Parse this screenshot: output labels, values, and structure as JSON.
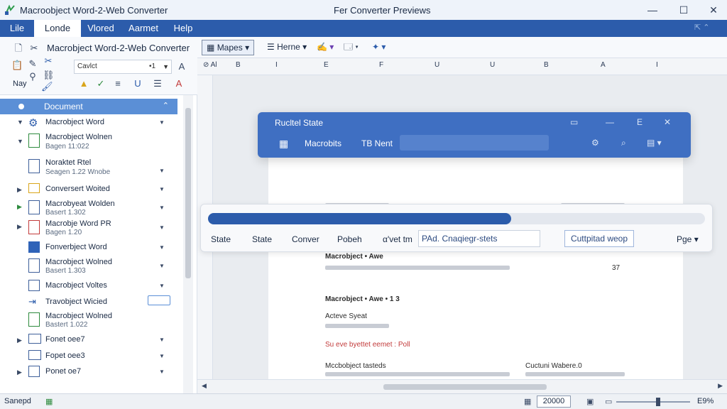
{
  "window": {
    "app_title": "Macroobject Word-2-Web Converter",
    "center_title": "Fer Converter Previews",
    "minimize_glyph": "—",
    "maximize_glyph": "☐",
    "close_glyph": "✕"
  },
  "menu": {
    "items": [
      "Lile",
      "Londe",
      "Vlored",
      "Aarmet",
      "Help"
    ],
    "active_index": 1
  },
  "ribbon": {
    "title": "Macrobject Word-2-Web Converter",
    "font_name": "Cavlct",
    "font_size": "•1",
    "nay_label": "Nay",
    "maps_label": "Mapes",
    "home_label": "Herne",
    "accent": "#2c5cab"
  },
  "sidebar": {
    "header": "Document",
    "items": [
      {
        "t1": "Macrobject Word",
        "t2": "",
        "icon": "gear-icon"
      },
      {
        "t1": "Macrobject Wolnen",
        "t2": "Bagen 11:022",
        "icon": "document-green-icon"
      },
      {
        "t1": "Noraktet Rtel",
        "t2": "Seagen 1.22 Wnobe",
        "icon": "document-icon"
      },
      {
        "t1": "Conversert Woited",
        "t2": "",
        "icon": "window-icon"
      },
      {
        "t1": "Macrobyeat Wolden",
        "t2": "Basert 1.302",
        "icon": "document-icon"
      },
      {
        "t1": "Macrobje Word PR",
        "t2": "Bagen 1.20",
        "icon": "document-red-icon"
      },
      {
        "t1": "Fonverbject Word",
        "t2": "",
        "icon": "folder-blue-icon"
      },
      {
        "t1": "Macrobject Wolned",
        "t2": "Basert 1.303",
        "icon": "document-icon"
      },
      {
        "t1": "Macrobject Voltes",
        "t2": "",
        "icon": "document-icon"
      },
      {
        "t1": "Travobject Wicied",
        "t2": "",
        "icon": "arrow-icon"
      },
      {
        "t1": "Macrobject Wolned",
        "t2": "Bastert 1.022",
        "icon": "document-green-icon"
      },
      {
        "t1": "Fonet oee7",
        "t2": "",
        "icon": "image-icon"
      },
      {
        "t1": "Fopet oee3",
        "t2": "",
        "icon": "image-icon"
      },
      {
        "t1": "Ponet oe7",
        "t2": "",
        "icon": "document-icon"
      }
    ]
  },
  "ruler": {
    "marks": [
      "B",
      "I",
      "E",
      "F",
      "U",
      "U",
      "B",
      "A",
      "I"
    ]
  },
  "dialog": {
    "title": "Rucltel State",
    "tab1": "Macrobits",
    "tab2": "TB Nent"
  },
  "progress": {
    "fraction": 0.61,
    "label1": "State",
    "label2": "State",
    "label3": "Conver",
    "label4": "Pobeh",
    "label5": "α'vet tm",
    "input_value": "PAd. Cnaqiegr-stets",
    "button_label": "Cuttpitad weop",
    "select_label": "Pge"
  },
  "document": {
    "line_heading": "Macrobject • Awe",
    "line_a": "Acteve Syeat",
    "line_red": "Su eve byettet eemet : Poll",
    "line_b": "Mccbobject tasteds",
    "line_right": "Cuctuni Wabere.0",
    "line_num": "37"
  },
  "status": {
    "left": "Sanepd",
    "zoom_value": "20000",
    "zoom_pct": "E9%"
  }
}
